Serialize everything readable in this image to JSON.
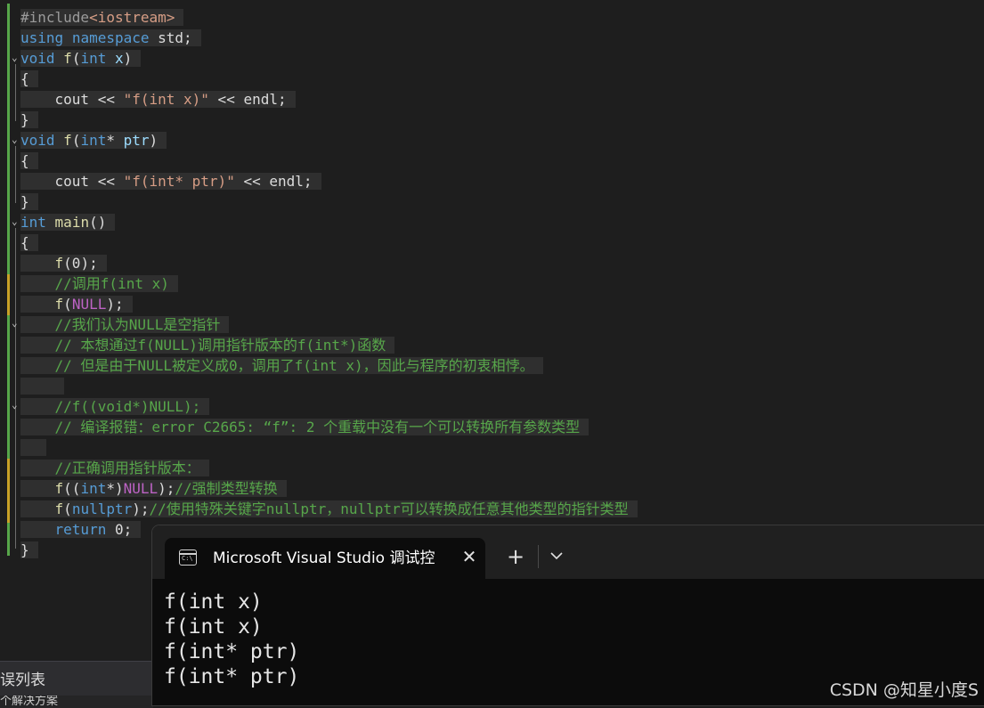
{
  "editor": {
    "lines": [
      {
        "parts": [
          {
            "t": "#include",
            "c": "pp"
          },
          {
            "t": "<iostream>",
            "c": "str"
          }
        ]
      },
      {
        "parts": [
          {
            "t": "using",
            "c": "kw"
          },
          {
            "t": " "
          },
          {
            "t": "namespace",
            "c": "kw"
          },
          {
            "t": " std;"
          }
        ]
      },
      {
        "parts": [
          {
            "t": "void",
            "c": "kw"
          },
          {
            "t": " "
          },
          {
            "t": "f",
            "c": "fn"
          },
          {
            "t": "("
          },
          {
            "t": "int",
            "c": "kw"
          },
          {
            "t": " "
          },
          {
            "t": "x",
            "c": "par"
          },
          {
            "t": ")"
          }
        ]
      },
      {
        "parts": [
          {
            "t": "{"
          }
        ]
      },
      {
        "parts": [
          {
            "t": "    cout << "
          },
          {
            "t": "\"f(int x)\"",
            "c": "str"
          },
          {
            "t": " << endl;"
          }
        ]
      },
      {
        "parts": [
          {
            "t": "}"
          }
        ]
      },
      {
        "parts": [
          {
            "t": "void",
            "c": "kw"
          },
          {
            "t": " "
          },
          {
            "t": "f",
            "c": "fn"
          },
          {
            "t": "("
          },
          {
            "t": "int",
            "c": "kw"
          },
          {
            "t": "* "
          },
          {
            "t": "ptr",
            "c": "par"
          },
          {
            "t": ")"
          }
        ]
      },
      {
        "parts": [
          {
            "t": "{"
          }
        ]
      },
      {
        "parts": [
          {
            "t": "    cout << "
          },
          {
            "t": "\"f(int* ptr)\"",
            "c": "str"
          },
          {
            "t": " << endl;"
          }
        ]
      },
      {
        "parts": [
          {
            "t": "}"
          }
        ]
      },
      {
        "parts": [
          {
            "t": "int",
            "c": "kw"
          },
          {
            "t": " "
          },
          {
            "t": "main",
            "c": "fn"
          },
          {
            "t": "()"
          }
        ]
      },
      {
        "parts": [
          {
            "t": "{"
          }
        ]
      },
      {
        "parts": [
          {
            "t": "    "
          },
          {
            "t": "f",
            "c": "fn"
          },
          {
            "t": "(0);"
          }
        ]
      },
      {
        "parts": [
          {
            "t": "    //调用f(int x)",
            "c": "cm"
          }
        ]
      },
      {
        "parts": [
          {
            "t": "    "
          },
          {
            "t": "f",
            "c": "fn"
          },
          {
            "t": "("
          },
          {
            "t": "NULL",
            "c": "mac"
          },
          {
            "t": ");"
          }
        ]
      },
      {
        "parts": [
          {
            "t": "    //我们认为NULL是空指针",
            "c": "cm"
          }
        ]
      },
      {
        "parts": [
          {
            "t": "    // 本想通过f(NULL)调用指针版本的f(int*)函数",
            "c": "cm"
          }
        ]
      },
      {
        "parts": [
          {
            "t": "    // 但是由于NULL被定义成0，调用了f(int x)，因此与程序的初衷相悖。",
            "c": "cm"
          }
        ]
      },
      {
        "parts": [
          {
            "t": "    "
          }
        ]
      },
      {
        "parts": [
          {
            "t": "    //f((void*)NULL);",
            "c": "cm"
          }
        ]
      },
      {
        "parts": [
          {
            "t": "    // 编译报错：error C2665: “f”: 2 个重载中没有一个可以转换所有参数类型",
            "c": "cm"
          }
        ]
      },
      {
        "parts": [
          {
            "t": "  "
          }
        ]
      },
      {
        "parts": [
          {
            "t": "    //正确调用指针版本：",
            "c": "cm"
          }
        ]
      },
      {
        "parts": [
          {
            "t": "    "
          },
          {
            "t": "f",
            "c": "fn"
          },
          {
            "t": "(("
          },
          {
            "t": "int",
            "c": "kw"
          },
          {
            "t": "*)"
          },
          {
            "t": "NULL",
            "c": "mac"
          },
          {
            "t": ");"
          },
          {
            "t": "//强制类型转换",
            "c": "cm"
          }
        ]
      },
      {
        "parts": [
          {
            "t": "    "
          },
          {
            "t": "f",
            "c": "fn"
          },
          {
            "t": "("
          },
          {
            "t": "nullptr",
            "c": "kw"
          },
          {
            "t": ");"
          },
          {
            "t": "//使用特殊关键字nullptr，nullptr可以转换成任意其他类型的指针类型",
            "c": "cm"
          }
        ]
      },
      {
        "parts": [
          {
            "t": "    "
          },
          {
            "t": "return",
            "c": "kw"
          },
          {
            "t": " 0;"
          }
        ]
      },
      {
        "parts": [
          {
            "t": "}"
          }
        ]
      }
    ]
  },
  "error_panel": {
    "title": "误列表",
    "subtitle": "个解决方案"
  },
  "terminal": {
    "tab_title": "Microsoft Visual Studio 调试控制台",
    "tab_icon_text": "C:\\",
    "close_glyph": "✕",
    "new_tab_glyph": "+",
    "output": [
      "f(int x)",
      "f(int x)",
      "f(int* ptr)",
      "f(int* ptr)"
    ]
  },
  "watermark": "CSDN @知星小度S",
  "colors": {
    "keyword": "#569cd6",
    "string": "#d69d85",
    "comment": "#57a64a",
    "function": "#dcdcaa",
    "macro": "#bd63c5"
  }
}
